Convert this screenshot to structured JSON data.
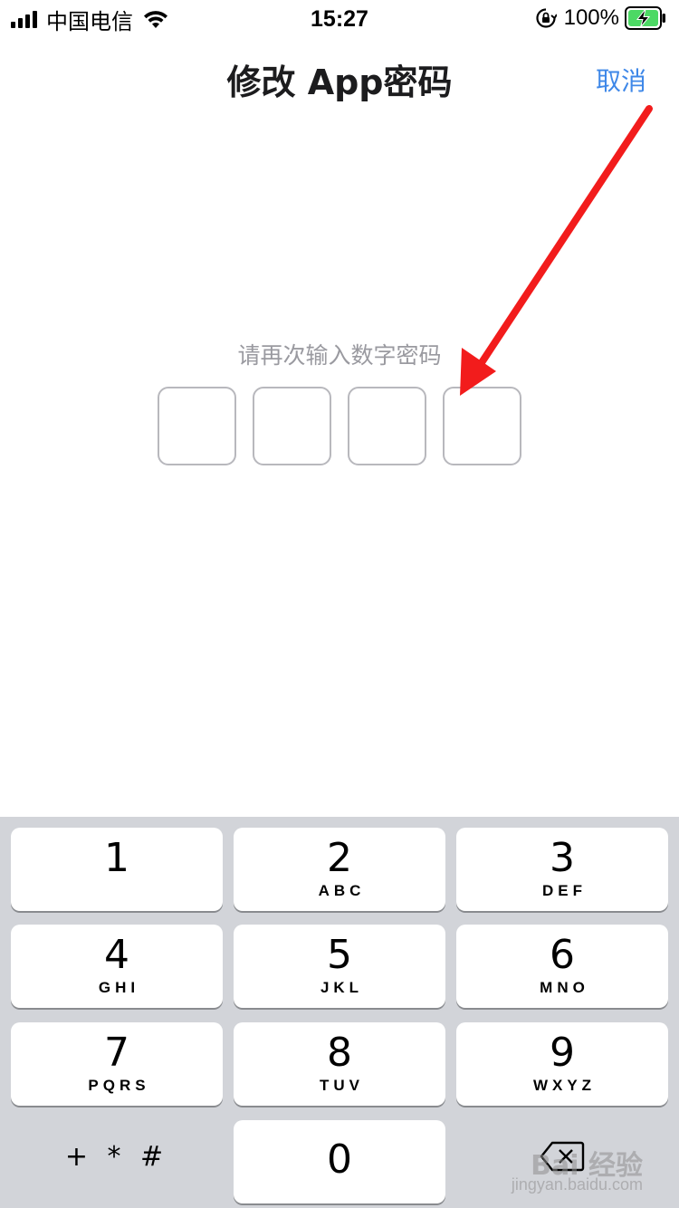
{
  "status_bar": {
    "carrier": "中国电信",
    "time": "15:27",
    "battery_percent": "100%"
  },
  "nav": {
    "title": "修改 App密码",
    "cancel_label": "取消"
  },
  "passcode": {
    "prompt": "请再次输入数字密码",
    "boxes": [
      "",
      "",
      "",
      ""
    ]
  },
  "keypad": {
    "keys": [
      {
        "digit": "1",
        "letters": ""
      },
      {
        "digit": "2",
        "letters": "ABC"
      },
      {
        "digit": "3",
        "letters": "DEF"
      },
      {
        "digit": "4",
        "letters": "GHI"
      },
      {
        "digit": "5",
        "letters": "JKL"
      },
      {
        "digit": "6",
        "letters": "MNO"
      },
      {
        "digit": "7",
        "letters": "PQRS"
      },
      {
        "digit": "8",
        "letters": "TUV"
      },
      {
        "digit": "9",
        "letters": "WXYZ"
      },
      {
        "digit": "0",
        "letters": ""
      }
    ],
    "symbols_label": "+ * #",
    "delete_icon": "delete-backspace-icon"
  },
  "watermark": {
    "logo": "Bai 经验",
    "url": "jingyan.baidu.com"
  },
  "colors": {
    "accent": "#3f88e8",
    "annotation_arrow": "#f21c1c",
    "keypad_bg": "#d2d4d9"
  }
}
